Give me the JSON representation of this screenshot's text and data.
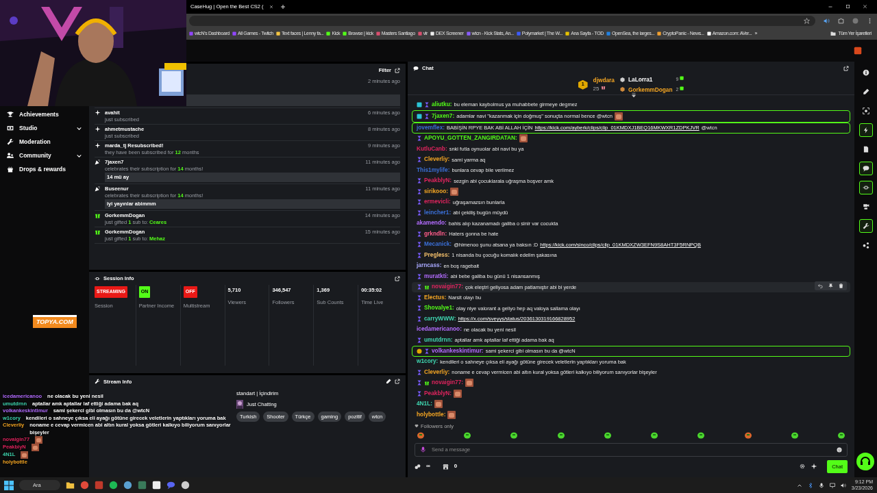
{
  "browser": {
    "tab_title": "CaseHug | Open the Best CS2 (",
    "bookmarks": [
      "wtcN's Dashboard",
      "All Games - Twitch",
      "Text faces | Lenny fa...",
      "Kick",
      "Browse | kick",
      "Masters Santiago",
      "vlr",
      "DEX Screener",
      "wtcn - Kick Stats, An...",
      "Polymarket | The W...",
      "Ana Sayfa - TOD",
      "OpenSea, the larges...",
      "CryptoPanic - News...",
      "Amazon.com: AVer..."
    ],
    "more": "»",
    "all_bookmarks": "Tüm Yer İşaretleri"
  },
  "sidebar": {
    "items": [
      {
        "kind": "trophy",
        "label": "Achievements",
        "expandable": false
      },
      {
        "kind": "studio",
        "label": "Studio",
        "expandable": true
      },
      {
        "kind": "wrench",
        "label": "Moderation",
        "expandable": false
      },
      {
        "kind": "people",
        "label": "Community",
        "expandable": true
      },
      {
        "kind": "gift",
        "label": "Drops & rewards",
        "expandable": false
      }
    ]
  },
  "activity": {
    "filter": "Filter",
    "items": [
      {
        "kind": "partial",
        "time": "2 minutes ago"
      },
      {
        "kind": "sub",
        "user": "avahit",
        "detail": "just subscribed",
        "time": "6 minutes ago"
      },
      {
        "kind": "sub",
        "user": "ahmetmustache",
        "detail": "just subscribed",
        "time": "8 minutes ago"
      },
      {
        "kind": "sub",
        "user": "marda_tj Resubscribed!",
        "detail": "they have been subscribed for **12** months",
        "time": "9 minutes ago"
      },
      {
        "kind": "celebrate",
        "user": "7jaxen7",
        "detail": "celebrates their subscription for **14** months!",
        "time": "11 minutes ago",
        "message": "14 mü ay"
      },
      {
        "kind": "celebrate",
        "user": "Buseenur",
        "detail": "celebrates their subscription for **14** months!",
        "time": "11 minutes ago",
        "message": "iyi yayınlar abimmm"
      },
      {
        "kind": "gift",
        "user": "GorkemmDogan",
        "detail": "just gifted **1** sub to: **Ceares**",
        "time": "14 minutes ago"
      },
      {
        "kind": "gift",
        "user": "GorkemmDogan",
        "detail": "just gifted **1** sub to: **Mehaz**",
        "time": "15 minutes ago"
      }
    ]
  },
  "session": {
    "title": "Session Info",
    "stats": [
      {
        "kind": "badge",
        "value": "STREAMING",
        "color": "#e91916",
        "label": "Session"
      },
      {
        "kind": "badge",
        "value": "ON",
        "color": "#53fc18",
        "label": "Partner Income"
      },
      {
        "kind": "badge",
        "value": "OFF",
        "color": "#e91916",
        "label": "Multistream"
      },
      {
        "kind": "number",
        "value": "5,710",
        "label": "Viewers"
      },
      {
        "kind": "number",
        "value": "346,547",
        "label": "Followers"
      },
      {
        "kind": "number",
        "value": "1,369",
        "label": "Sub Counts"
      },
      {
        "kind": "number",
        "value": "00:35:02",
        "label": "Time Live"
      }
    ]
  },
  "stream_info": {
    "title": "Stream Info",
    "stream_title": "standart | İçindirim",
    "category": "Just Chatting",
    "tags": [
      "Turkish",
      "Shooter",
      "Türkçe",
      "gaming",
      "pozitif",
      "wtcn"
    ]
  },
  "logo": "TOPYA.COM",
  "overlay_chat": [
    {
      "user": "icedamericanoo",
      "color": "#b36cff",
      "text": "ne olacak bu yeni nesil"
    },
    {
      "user": "umutdrnn",
      "color": "#3fd6b0",
      "text": "aptallar amk aptallar laf ettiği adama bak aq"
    },
    {
      "user": "volkankeskintimur",
      "color": "#b36cff",
      "text": "sami şekerci gibi olmasın bu da @wtcN"
    },
    {
      "user": "w1cory",
      "color": "#3fd6b0",
      "text": "kendileri o sahneye çıksa eli ayağı götüne girecek veletlerin yaptıkları yoruma bak"
    },
    {
      "user": "Cleverliy",
      "color": "#f5a623",
      "text": "noname e cevap vermicen abi altın kural yoksa götleri kalkıyo biliyorum sanıyorlar bişeyler"
    },
    {
      "user": "novaigin77",
      "color": "#e0245e",
      "emote": true
    },
    {
      "user": "PeakbiyN",
      "color": "#e0245e",
      "emote": true
    },
    {
      "user": "4N1L",
      "color": "#3fd6b0",
      "emote": true
    },
    {
      "user": "holybottle",
      "color": "#f5a623"
    }
  ],
  "chat": {
    "title": "Chat",
    "leader": {
      "rank": "1",
      "user": "djwdara",
      "count": "25"
    },
    "runners": [
      {
        "user": "LaLorra1",
        "count": "9",
        "color": "#ffffff"
      },
      {
        "user": "GorkemmDogan",
        "count": "2",
        "color": "#f5a623"
      }
    ],
    "messages": [
      {
        "badges": [
          {
            "kind": "og"
          },
          {
            "kind": "sub"
          }
        ],
        "user": "aliutku:",
        "color": "#53fc18",
        "text": "bu eleman kaybolmus ya muhabbete girmeye degmez",
        "highlighted": false,
        "hovered": false
      },
      {
        "badges": [
          {
            "kind": "og"
          },
          {
            "kind": "sub"
          }
        ],
        "user": "7jaxen7:",
        "color": "#53fc18",
        "text": "adamlar navi \"kazanmak için doğmuş\" sonuçta normal bence @wtcn",
        "emote": true,
        "highlighted": true,
        "hovered": false
      },
      {
        "user": "jovemflex:",
        "color": "#3b6fd6",
        "text": "BABİŞİN RPYE BAK ABİ ALLAH İÇİN",
        "link": "https://kick.com/ayberk/clips/clip_01KMDXJ1BEQ16MKWXR1ZDPKJVR",
        "text_after": "@wtcn",
        "highlighted": true,
        "hovered": false
      },
      {
        "badges": [
          {
            "kind": "sub"
          }
        ],
        "user": "APOYU_GOTTEN_ZANGIRDATAN:",
        "color": "#53fc18",
        "emote": true,
        "highlighted": false,
        "hovered": false
      },
      {
        "user": "KutluCanb:",
        "color": "#e0245e",
        "text": "snki futla oynuolar abi navi bu ya",
        "highlighted": false,
        "hovered": false
      },
      {
        "badges": [
          {
            "kind": "sub"
          }
        ],
        "user": "Cleverliy:",
        "color": "#f5a623",
        "text": "sami yarma aq",
        "highlighted": false,
        "hovered": false
      },
      {
        "user": "This1mylife:",
        "color": "#3b6fd6",
        "text": "bunlara cevap bile verilmez",
        "highlighted": false,
        "hovered": false
      },
      {
        "badges": [
          {
            "kind": "sub"
          }
        ],
        "user": "PeakblyN:",
        "color": "#e0245e",
        "text": "sezgin abi çocuklarala uğraşma boşver amk",
        "highlighted": false,
        "hovered": false
      },
      {
        "badges": [
          {
            "kind": "sub"
          }
        ],
        "user": "sirikooo:",
        "color": "#f5a623",
        "emote": true,
        "highlighted": false,
        "hovered": false
      },
      {
        "badges": [
          {
            "kind": "sub"
          }
        ],
        "user": "ermevicli:",
        "color": "#e0245e",
        "text": "uğraşamazsın bunlarla",
        "highlighted": false,
        "hovered": false
      },
      {
        "badges": [
          {
            "kind": "sub"
          }
        ],
        "user": "leincher1:",
        "color": "#3b6fd6",
        "text": "abi çekiliş bugün müydü",
        "highlighted": false,
        "hovered": false
      },
      {
        "user": "akamendo:",
        "color": "#b36cff",
        "text": "bahis alıp kazanamadı galiba o sinir var cocukta",
        "highlighted": false,
        "hovered": false
      },
      {
        "badges": [
          {
            "kind": "sub"
          }
        ],
        "user": "grkndln:",
        "color": "#ff5c8a",
        "text": "Haters gonna be hate",
        "highlighted": false,
        "hovered": false
      },
      {
        "badges": [
          {
            "kind": "sub"
          }
        ],
        "user": "Mecanick:",
        "color": "#3b6fd6",
        "text": "@himenoo şunu atsana ya baksın :D",
        "link": "https://kick.com/sinco/clips/clip_01KMDXZW3EFN9S8AHT3F5RNPQB",
        "highlighted": false,
        "hovered": false
      },
      {
        "badges": [
          {
            "kind": "sub"
          }
        ],
        "user": "Pregless:",
        "color": "#f5c16c",
        "text": "1 nisanda bu çocuğu komalık edelim şakasına",
        "highlighted": false,
        "hovered": false
      },
      {
        "user": "jarncass:",
        "color": "#a9a9ff",
        "text": "en boş ragebait",
        "highlighted": false,
        "hovered": false
      },
      {
        "badges": [
          {
            "kind": "sub"
          }
        ],
        "user": "muratkti:",
        "color": "#b36cff",
        "text": "abi bebe galiba bu günü 1 nisansanmış",
        "highlighted": false,
        "hovered": false
      },
      {
        "badges": [
          {
            "kind": "sub"
          },
          {
            "kind": "gift"
          }
        ],
        "user": "novaigin77:",
        "color": "#e0245e",
        "text": "çok eleştri geliyosa adam patlamıştır abi bi yerde",
        "highlighted": false,
        "hovered": true
      },
      {
        "badges": [
          {
            "kind": "sub"
          }
        ],
        "user": "Electus:",
        "color": "#f5a623",
        "text": "Narsit olayı bu",
        "highlighted": false,
        "hovered": false
      },
      {
        "badges": [
          {
            "kind": "sub"
          }
        ],
        "user": "Shovalye1:",
        "color": "#53fc18",
        "text": "olay niye valorant a geliyo hep aq valoya sallama olayı",
        "highlighted": false,
        "hovered": false
      },
      {
        "badges": [
          {
            "kind": "sub"
          }
        ],
        "user": "carryWWW:",
        "color": "#3fd6b0",
        "link": "https://x.com/sveyys/status/2036130319166828952",
        "highlighted": false,
        "hovered": false
      },
      {
        "user": "icedamericanoo:",
        "color": "#b36cff",
        "text": "ne olacak bu yeni nesil",
        "highlighted": false,
        "hovered": false
      },
      {
        "badges": [
          {
            "kind": "sub"
          }
        ],
        "user": "umutdrnn:",
        "color": "#3fd6b0",
        "text": "aptallar amk aptallar laf ettiği adama bak aq",
        "highlighted": false,
        "hovered": false
      },
      {
        "badges": [
          {
            "kind": "gifter"
          },
          {
            "kind": "sub"
          }
        ],
        "user": "volkankeskintimur:",
        "color": "#b36cff",
        "text": "sami şekerci gibi olmasın bu da @wtcN",
        "highlighted": true,
        "hovered": false
      },
      {
        "user": "w1cory:",
        "color": "#3fd6b0",
        "text": "kendileri o sahneye çıksa eli ayağı götüne girecek veletlerin yaptıkları yoruma bak",
        "highlighted": false,
        "hovered": false
      },
      {
        "badges": [
          {
            "kind": "sub"
          }
        ],
        "user": "Cleverliy:",
        "color": "#f5a623",
        "text": "noname e cevap vermicen abi altın kural yoksa götleri kalkıyo biliyorum sanıyorlar bişeyler",
        "highlighted": false,
        "hovered": false
      },
      {
        "badges": [
          {
            "kind": "sub"
          },
          {
            "kind": "gift"
          }
        ],
        "user": "novaigin77:",
        "color": "#e0245e",
        "emote": true,
        "highlighted": false,
        "hovered": false
      },
      {
        "badges": [
          {
            "kind": "sub"
          }
        ],
        "user": "PeakblyN:",
        "color": "#e0245e",
        "emote": true,
        "highlighted": false,
        "hovered": false
      },
      {
        "user": "4N1L:",
        "color": "#3fd6b0",
        "emote": true,
        "highlighted": false,
        "hovered": false
      },
      {
        "user": "holybottle:",
        "color": "#f5a623",
        "emote": true,
        "highlighted": false,
        "hovered": false
      }
    ],
    "followers_only": "Followers only",
    "placeholder": "Send a message",
    "points": "∞",
    "store_count": "0",
    "send": "Chat"
  },
  "rail": [
    {
      "kind": "info",
      "highlighted": false
    },
    {
      "kind": "pencil",
      "highlighted": false
    },
    {
      "kind": "capture",
      "highlighted": false
    },
    {
      "kind": "bolt",
      "highlighted": true
    },
    {
      "kind": "note",
      "highlighted": false
    },
    {
      "kind": "chat",
      "highlighted": true
    },
    {
      "kind": "link",
      "highlighted": true
    },
    {
      "kind": "camera",
      "highlighted": false
    },
    {
      "kind": "wrench",
      "highlighted": true
    },
    {
      "kind": "share",
      "highlighted": false
    }
  ],
  "taskbar": {
    "search": "Ara",
    "time": "9:12 PM",
    "date": "3/23/2026"
  }
}
